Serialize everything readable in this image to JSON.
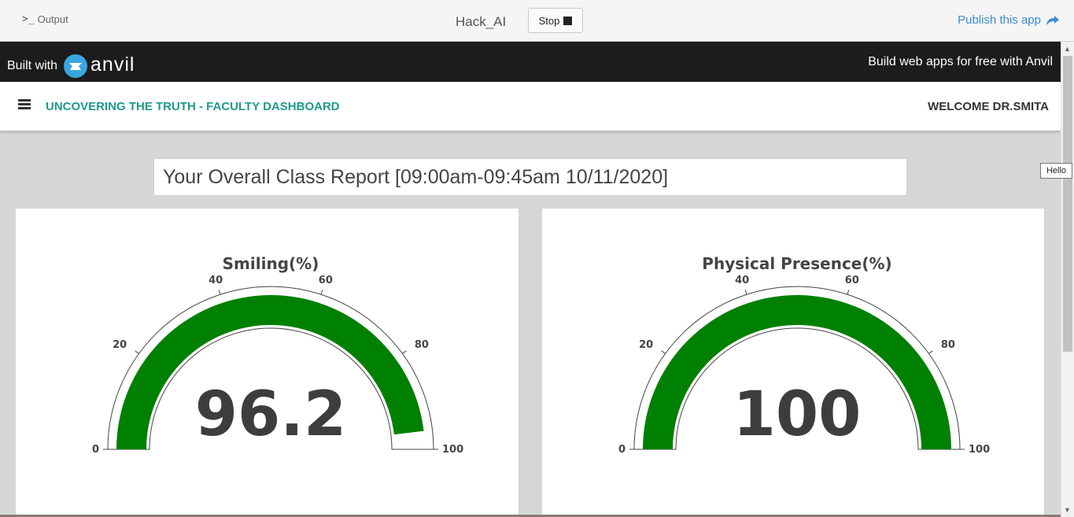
{
  "toolbar": {
    "output_label": "Output",
    "app_name": "Hack_AI",
    "stop_label": "Stop",
    "publish_label": "Publish this app"
  },
  "banner": {
    "built_with": "Built with",
    "logo_text": "anvil",
    "right_text": "Build web apps for free with Anvil"
  },
  "header": {
    "title": "UNCOVERING THE TRUTH - FACULTY DASHBOARD",
    "welcome": "WELCOME DR.SMITA"
  },
  "report": {
    "title": "Your Overall Class Report [09:00am-09:45am 10/11/2020]"
  },
  "tooltip": "Hello",
  "colors": {
    "gauge_fill": "#008000",
    "title_teal": "#1e9a8a",
    "link_blue": "#3a8dd4"
  },
  "chart_data": [
    {
      "type": "gauge",
      "title": "Smiling(%)",
      "value": 96.2,
      "value_text": "96.2",
      "range": [
        0,
        100
      ],
      "ticks": [
        "0",
        "20",
        "40",
        "60",
        "80",
        "100"
      ]
    },
    {
      "type": "gauge",
      "title": "Physical Presence(%)",
      "value": 100,
      "value_text": "100",
      "range": [
        0,
        100
      ],
      "ticks": [
        "0",
        "20",
        "40",
        "60",
        "80",
        "100"
      ]
    }
  ]
}
